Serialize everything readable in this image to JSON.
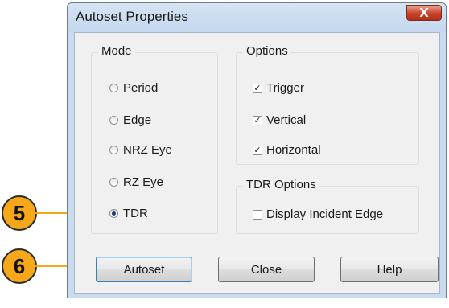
{
  "window": {
    "title": "Autoset Properties",
    "close_glyph": "X"
  },
  "mode": {
    "label": "Mode",
    "options": [
      "Period",
      "Edge",
      "NRZ Eye",
      "RZ Eye",
      "TDR"
    ],
    "selected": "TDR"
  },
  "options": {
    "label": "Options",
    "items": [
      {
        "label": "Trigger",
        "checked": true
      },
      {
        "label": "Vertical",
        "checked": true
      },
      {
        "label": "Horizontal",
        "checked": true
      }
    ]
  },
  "tdr_options": {
    "label": "TDR Options",
    "items": [
      {
        "label": "Display Incident Edge",
        "checked": false
      }
    ]
  },
  "buttons": {
    "autoset": "Autoset",
    "close": "Close",
    "help": "Help"
  },
  "callouts": {
    "first": "5",
    "second": "6",
    "color": "#f6a81a"
  },
  "check_glyph": "✓",
  "accent": "#1f3e77"
}
